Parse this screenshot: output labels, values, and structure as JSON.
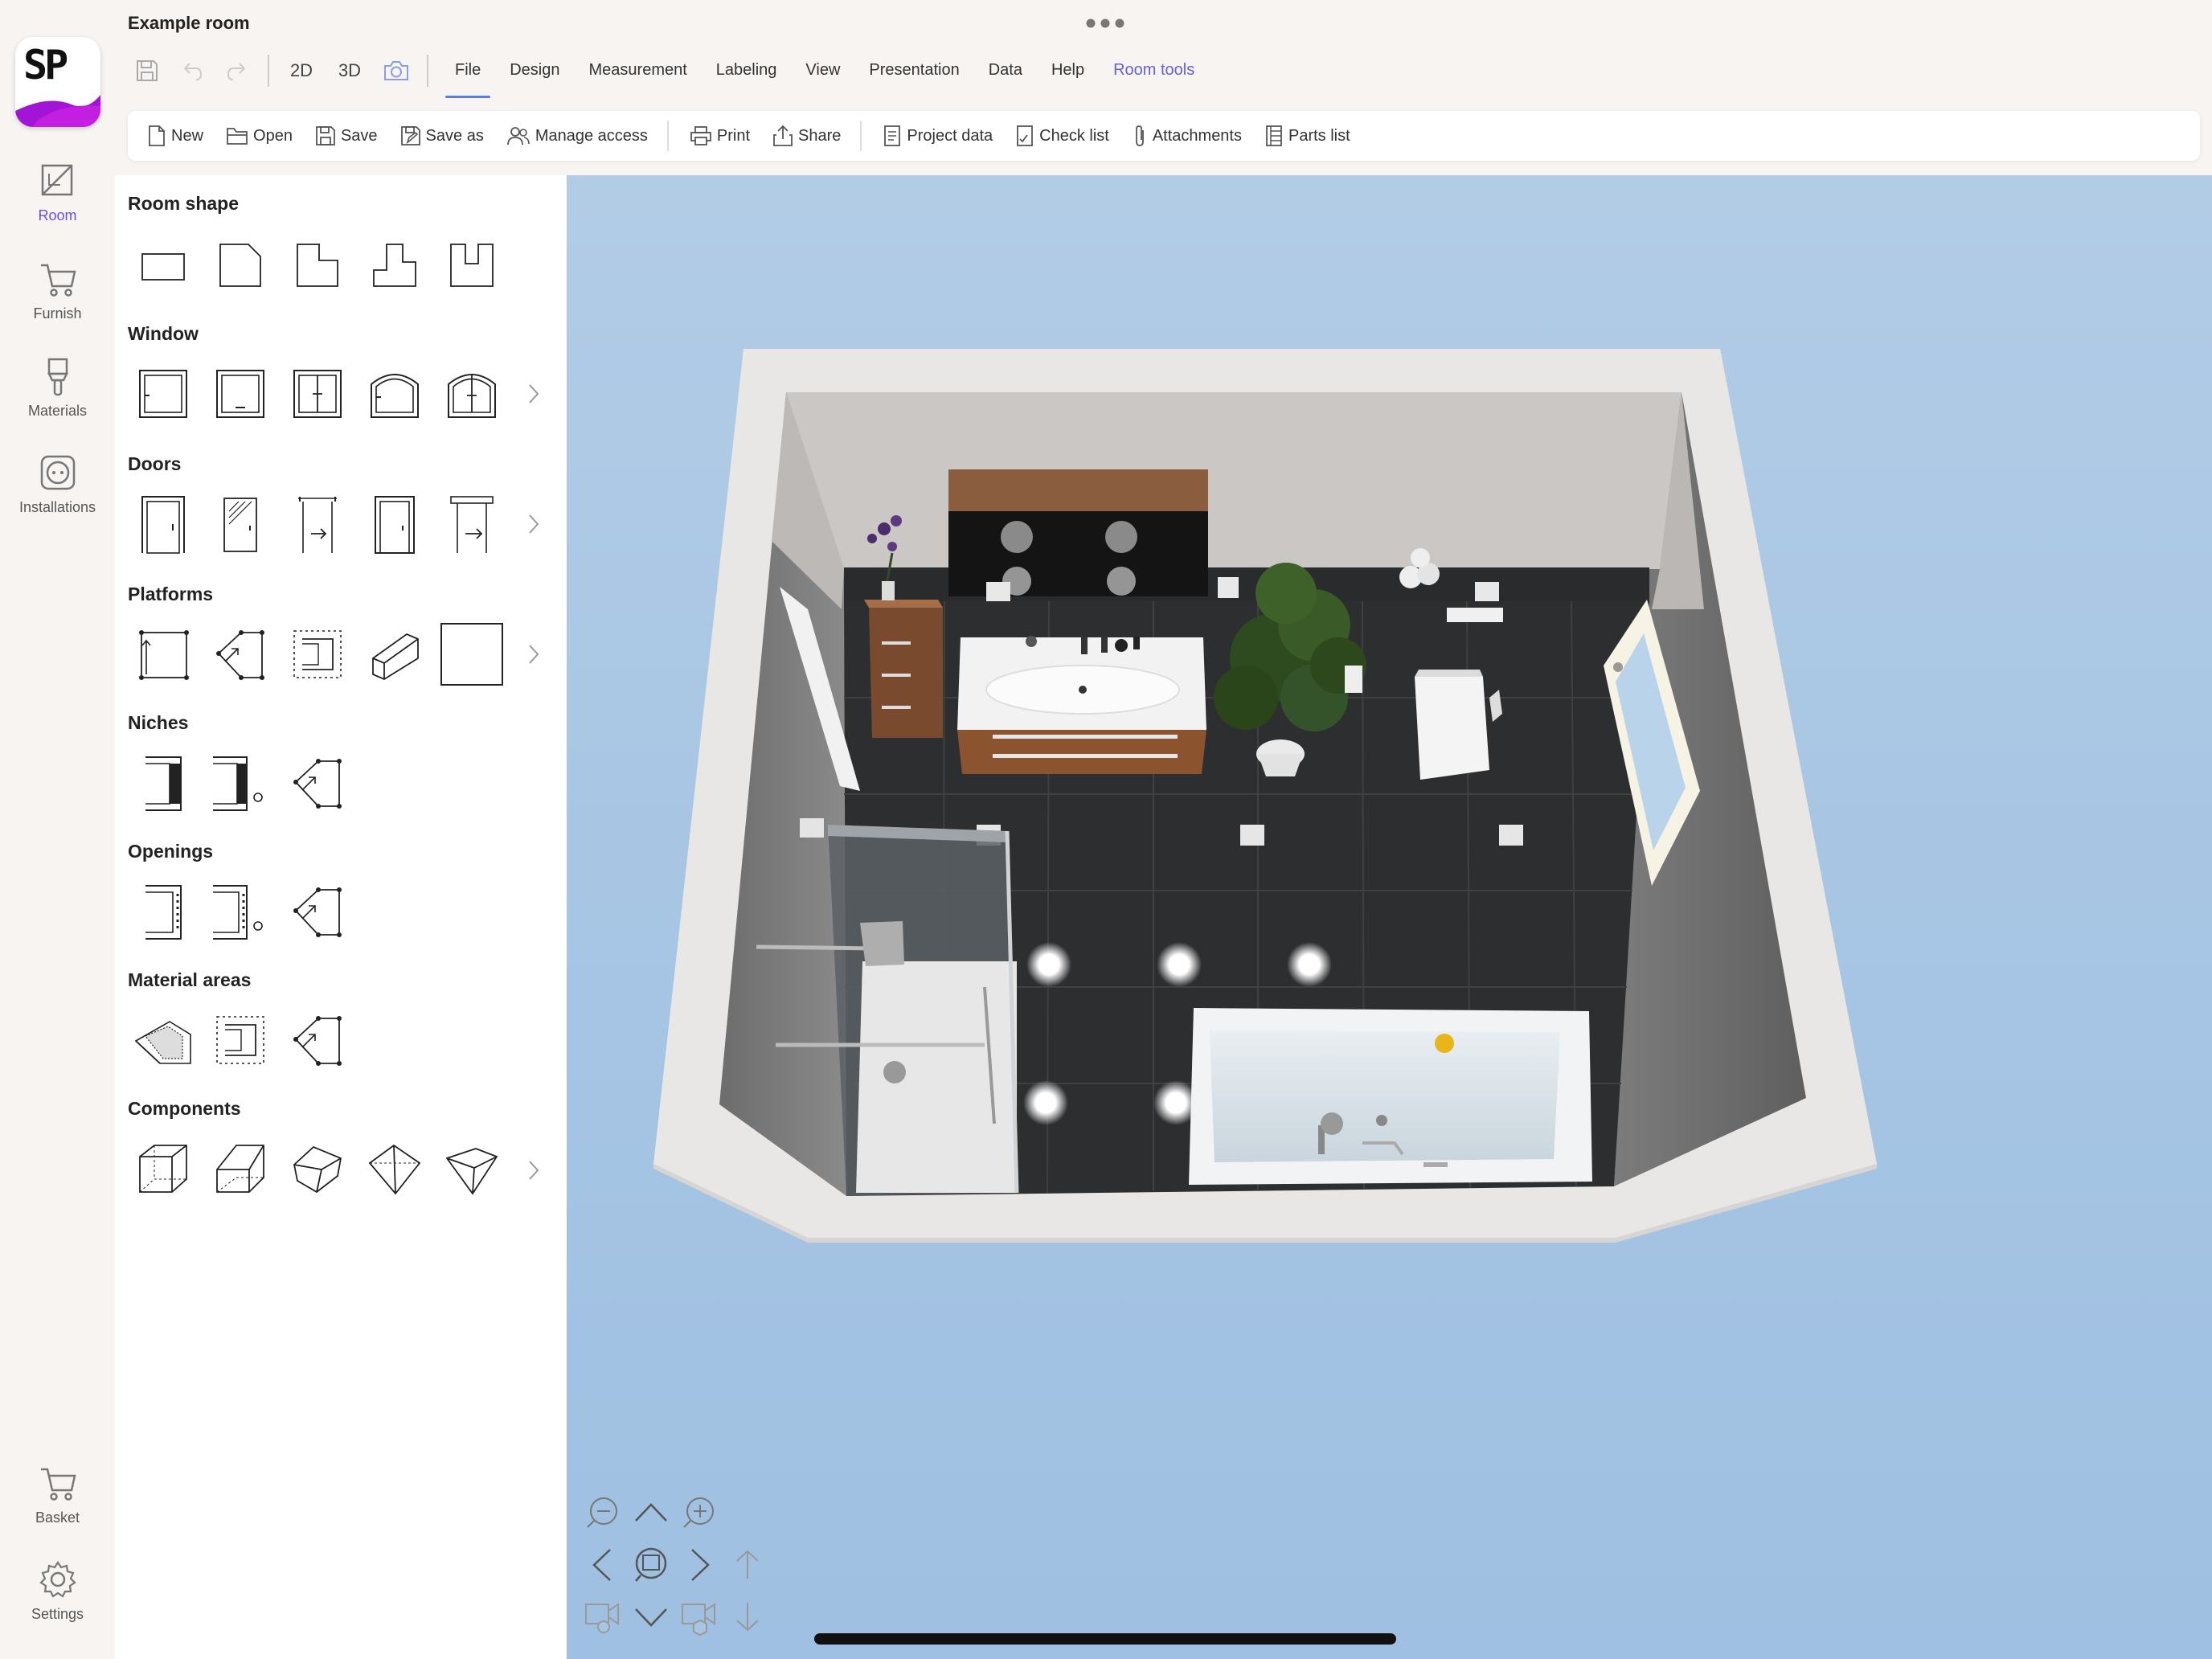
{
  "app": {
    "title": "Example room",
    "logo_text": "SP"
  },
  "rail": {
    "items": [
      {
        "label": "Room",
        "icon": "room-ruler-icon",
        "active": true
      },
      {
        "label": "Furnish",
        "icon": "cart-icon"
      },
      {
        "label": "Materials",
        "icon": "paint-brush-icon"
      },
      {
        "label": "Installations",
        "icon": "power-socket-icon"
      }
    ],
    "bottom": [
      {
        "label": "Basket",
        "icon": "basket-icon"
      },
      {
        "label": "Settings",
        "icon": "gear-icon"
      }
    ]
  },
  "quick_access": {
    "view_2d": "2D",
    "view_3d": "3D"
  },
  "menu": {
    "items": [
      {
        "label": "File",
        "active": true
      },
      {
        "label": "Design"
      },
      {
        "label": "Measurement"
      },
      {
        "label": "Labeling"
      },
      {
        "label": "View"
      },
      {
        "label": "Presentation"
      },
      {
        "label": "Data"
      },
      {
        "label": "Help"
      },
      {
        "label": "Room tools",
        "accent": true
      }
    ]
  },
  "toolbar": {
    "new": "New",
    "open": "Open",
    "save": "Save",
    "save_as": "Save as",
    "manage_access": "Manage access",
    "print": "Print",
    "share": "Share",
    "project_data": "Project data",
    "check_list": "Check list",
    "attachments": "Attachments",
    "parts_list": "Parts list"
  },
  "panel": {
    "sections": [
      "Room shape",
      "Window",
      "Doors",
      "Platforms",
      "Niches",
      "Openings",
      "Material areas",
      "Components"
    ]
  },
  "colors": {
    "accent": "#6a4fd8",
    "tab_underline": "#5a7de0",
    "viewport_sky": "#a8c6e4"
  }
}
